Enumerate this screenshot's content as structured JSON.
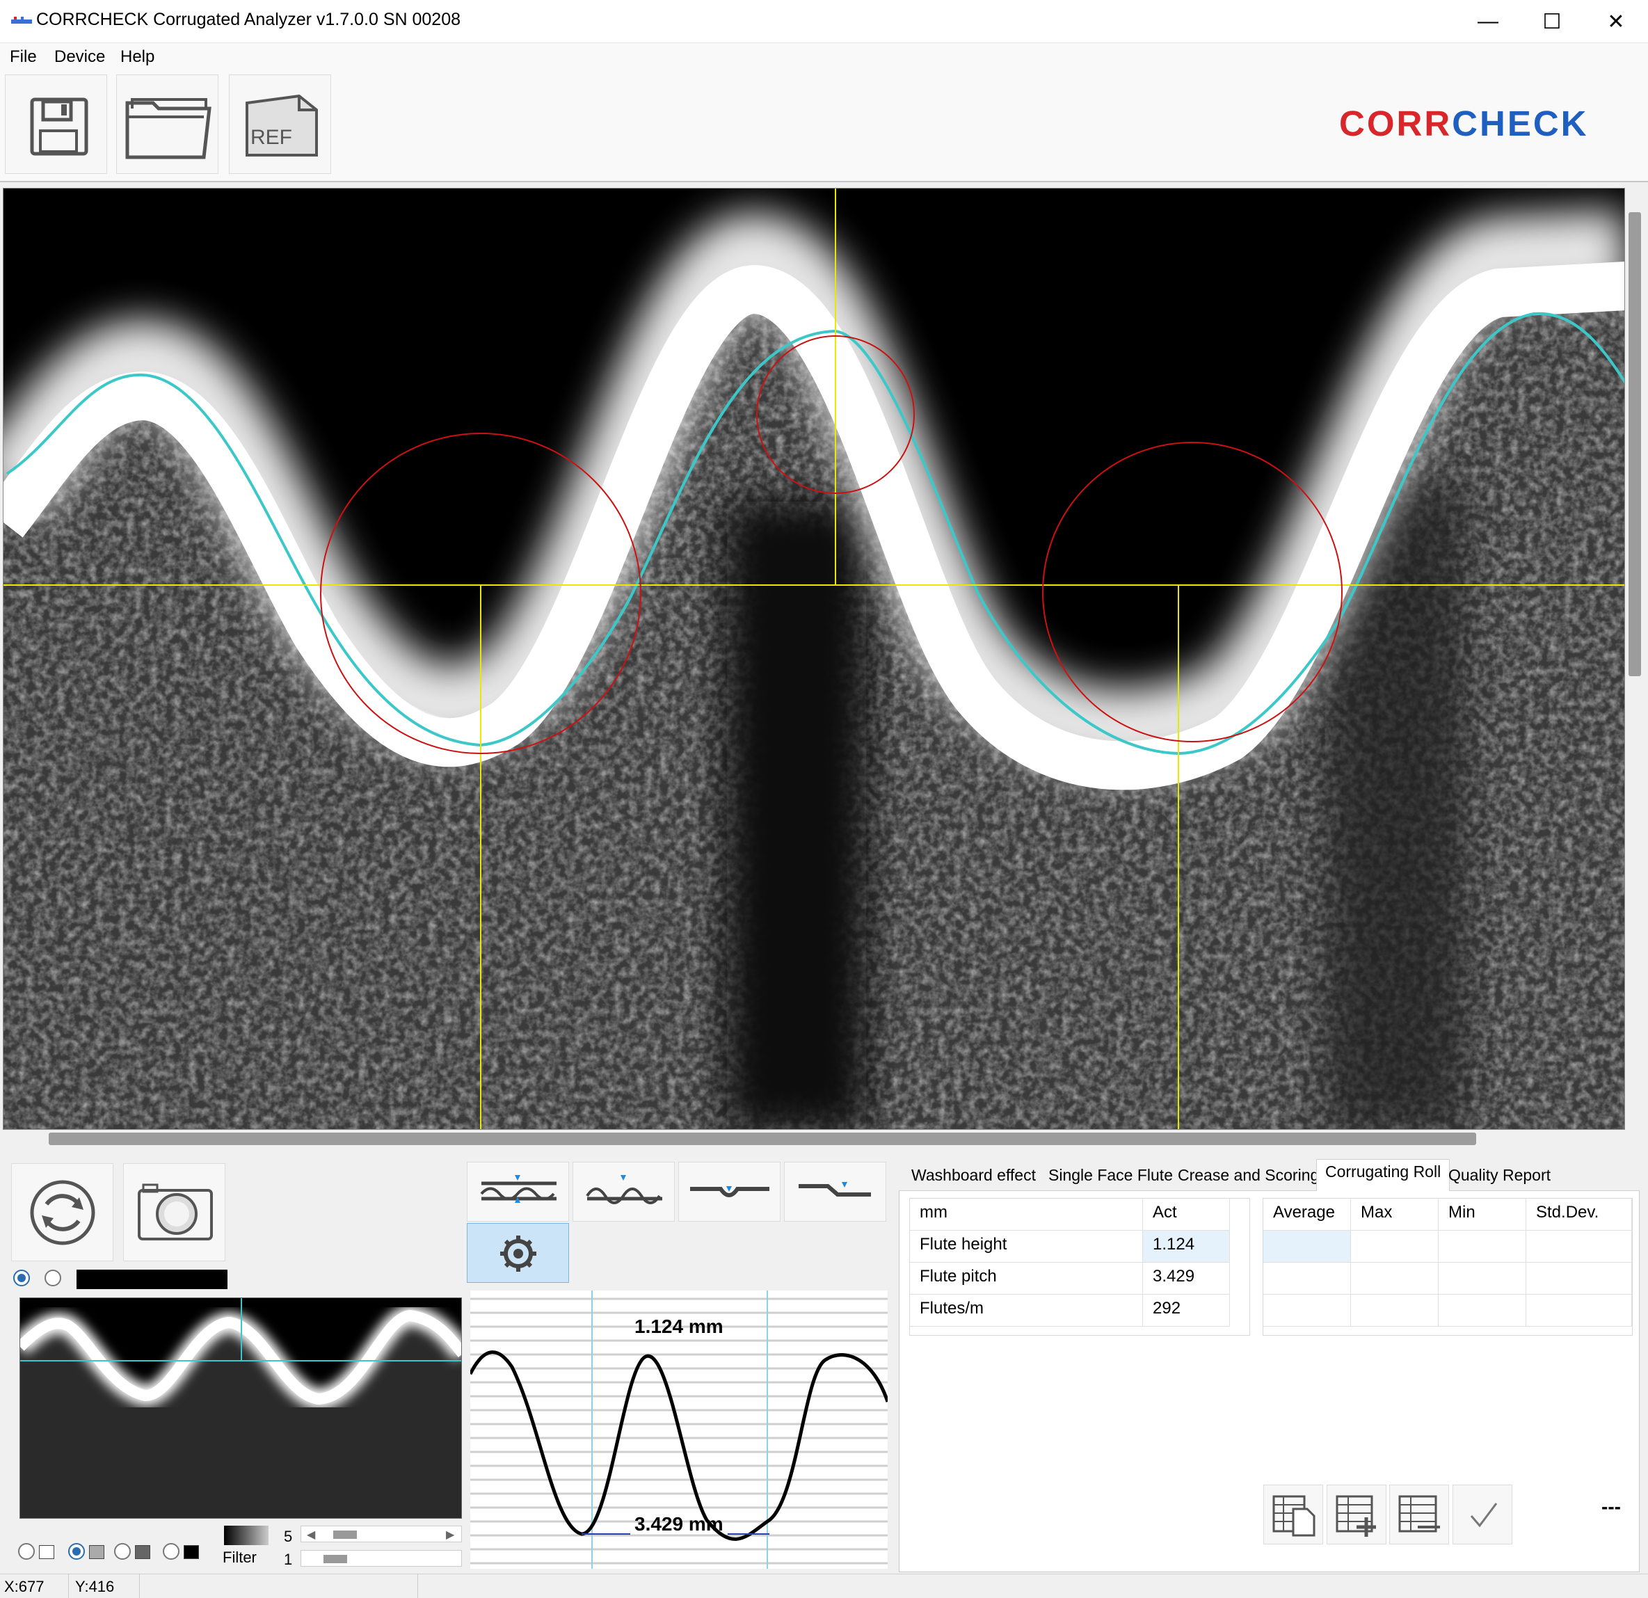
{
  "window": {
    "title": "CORRCHECK Corrugated Analyzer v1.7.0.0 SN 00208",
    "minimize_glyph": "—",
    "maximize_glyph": "☐",
    "close_glyph": "✕"
  },
  "menu": {
    "items": [
      "File",
      "Device",
      "Help"
    ]
  },
  "toolbar": {
    "save_icon": "floppy-disk-icon",
    "open_icon": "folder-icon",
    "ref_label": "REF"
  },
  "logo": {
    "part1": "CORR",
    "part2": "CHECK",
    "color1": "#d9262b",
    "color2": "#1f5fbf"
  },
  "bottom_left": {
    "refresh_icon": "refresh-icon",
    "camera_icon": "camera-icon",
    "slider_value_top": "5",
    "slider_value_bottom": "1",
    "filter_label": "Filter"
  },
  "graph": {
    "height_label": "1.124 mm",
    "pitch_label": "3.429 mm"
  },
  "tabs": [
    "Washboard effect",
    "Single Face Flute",
    "Crease and Scoring",
    "Corrugating Roll",
    "Quality Report"
  ],
  "active_tab": "Corrugating Roll",
  "measure_table": {
    "headers": [
      "mm",
      "Act"
    ],
    "rows": [
      {
        "label": "Flute height",
        "act": "1.124"
      },
      {
        "label": "Flute pitch",
        "act": "3.429"
      },
      {
        "label": "Flutes/m",
        "act": "292"
      }
    ]
  },
  "stats_table": {
    "headers": [
      "Average",
      "Max",
      "Min",
      "Std.Dev."
    ]
  },
  "dash_text": "---",
  "status": {
    "x": "X:677",
    "y": "Y:416"
  },
  "colors": {
    "fit_curve": "#3cc8c8",
    "circle": "#cc1111",
    "crosshair": "#e8e800",
    "accent": "#2b6cb0"
  }
}
